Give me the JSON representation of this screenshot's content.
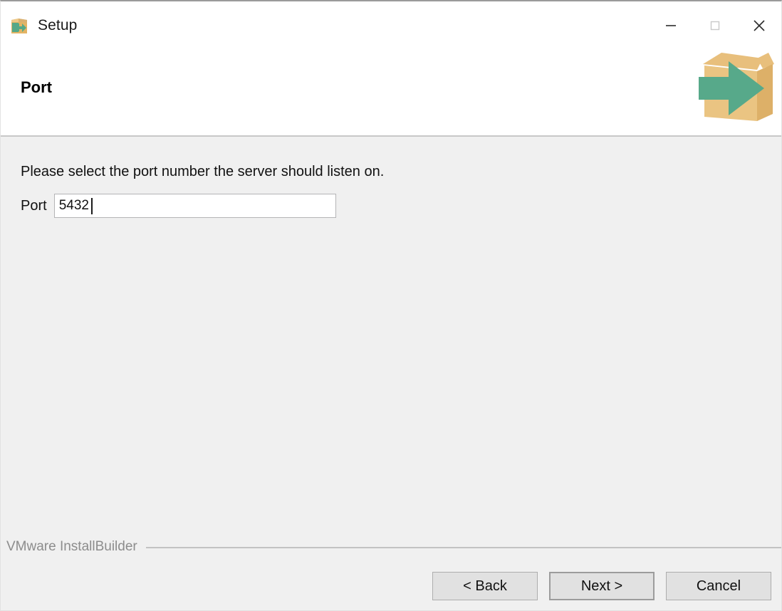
{
  "window": {
    "title": "Setup",
    "app_icon": "setup-box-arrow-icon",
    "controls": [
      {
        "name": "minimize-button",
        "glyph": "minimize-icon",
        "label": "Minimize"
      },
      {
        "name": "maximize-button",
        "glyph": "maximize-icon",
        "label": "Maximize"
      },
      {
        "name": "close-button",
        "glyph": "close-icon",
        "label": "Close"
      }
    ]
  },
  "header": {
    "page_title": "Port",
    "logo_icon": "open-box-with-green-arrow-icon"
  },
  "main": {
    "instruction": "Please select the port number the server should listen on.",
    "port_field": {
      "label": "Port",
      "value": "5432",
      "placeholder": ""
    }
  },
  "footer": {
    "brand": "VMware InstallBuilder",
    "buttons": [
      {
        "name": "back-button",
        "label": "< Back",
        "default": false
      },
      {
        "name": "next-button",
        "label": "Next >",
        "default": true
      },
      {
        "name": "cancel-button",
        "label": "Cancel",
        "default": false
      }
    ]
  },
  "colors": {
    "box_tan": "#e3b464",
    "box_tan_light": "#edc887",
    "box_tan_dark": "#d2a css",
    "arrow_green": "#55a888",
    "content_bg": "#f0f0f0",
    "header_bg": "#ffffff",
    "button_bg": "#e1e1e1",
    "brand_text": "#8c8c8c"
  }
}
